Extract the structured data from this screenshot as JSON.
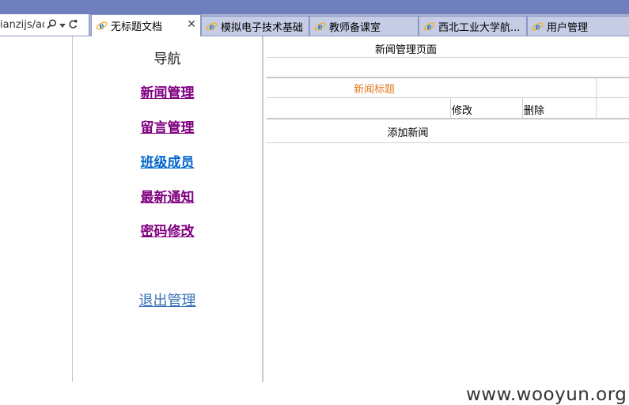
{
  "browser": {
    "address_text": "ianzijs/adm",
    "tabs": [
      {
        "title": "无标题文档",
        "active": true,
        "closable": true
      },
      {
        "title": "模拟电子技术基础",
        "active": false
      },
      {
        "title": "教师备课室",
        "active": false
      },
      {
        "title": "西北工业大学航...",
        "active": false
      },
      {
        "title": "用户管理",
        "active": false
      }
    ],
    "icons": {
      "search": "search-icon",
      "dropdown": "chevron-down-icon",
      "refresh": "refresh-icon",
      "tab": "ie-icon",
      "close": "close-icon"
    },
    "colors": {
      "chrome_top": "#6f7fbe",
      "tabbar": "#aab3d5",
      "ie_blue": "#1a75d1",
      "ie_ring": "#f2b01e"
    }
  },
  "nav": {
    "title": "导航",
    "links": [
      {
        "label": "新闻管理",
        "visited": true
      },
      {
        "label": "留言管理",
        "visited": true
      },
      {
        "label": "班级成员",
        "visited": false
      },
      {
        "label": "最新通知",
        "visited": true
      },
      {
        "label": "密码修改",
        "visited": true
      }
    ],
    "logout": "退出管理"
  },
  "main": {
    "title": "新闻管理页面",
    "table": {
      "header": "新闻标题",
      "row_actions": {
        "edit": "修改",
        "delete": "删除"
      }
    },
    "add_news": "添加新闻"
  },
  "watermark": "www.wooyun.org"
}
